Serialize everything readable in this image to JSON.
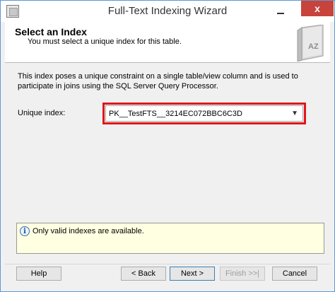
{
  "window": {
    "title": "Full-Text Indexing Wizard",
    "close_glyph": "x",
    "minimize_glyph": ""
  },
  "header": {
    "title": "Select an Index",
    "subtitle": "You must select a unique index for this table.",
    "icon_text": "AZ"
  },
  "body": {
    "description": "This index poses a unique constraint on a single table/view column and is used to participate in joins using the SQL Server Query Processor.",
    "unique_index_label": "Unique index:",
    "unique_index_value": "PK__TestFTS__3214EC072BBC6C3D",
    "info_message": "Only valid indexes are available."
  },
  "footer": {
    "help": "Help",
    "back": "< Back",
    "next": "Next >",
    "finish": "Finish >>|",
    "cancel": "Cancel"
  },
  "colors": {
    "highlight_border": "#e0161c",
    "close_button": "#c7433b",
    "info_background": "#ffffe1"
  }
}
